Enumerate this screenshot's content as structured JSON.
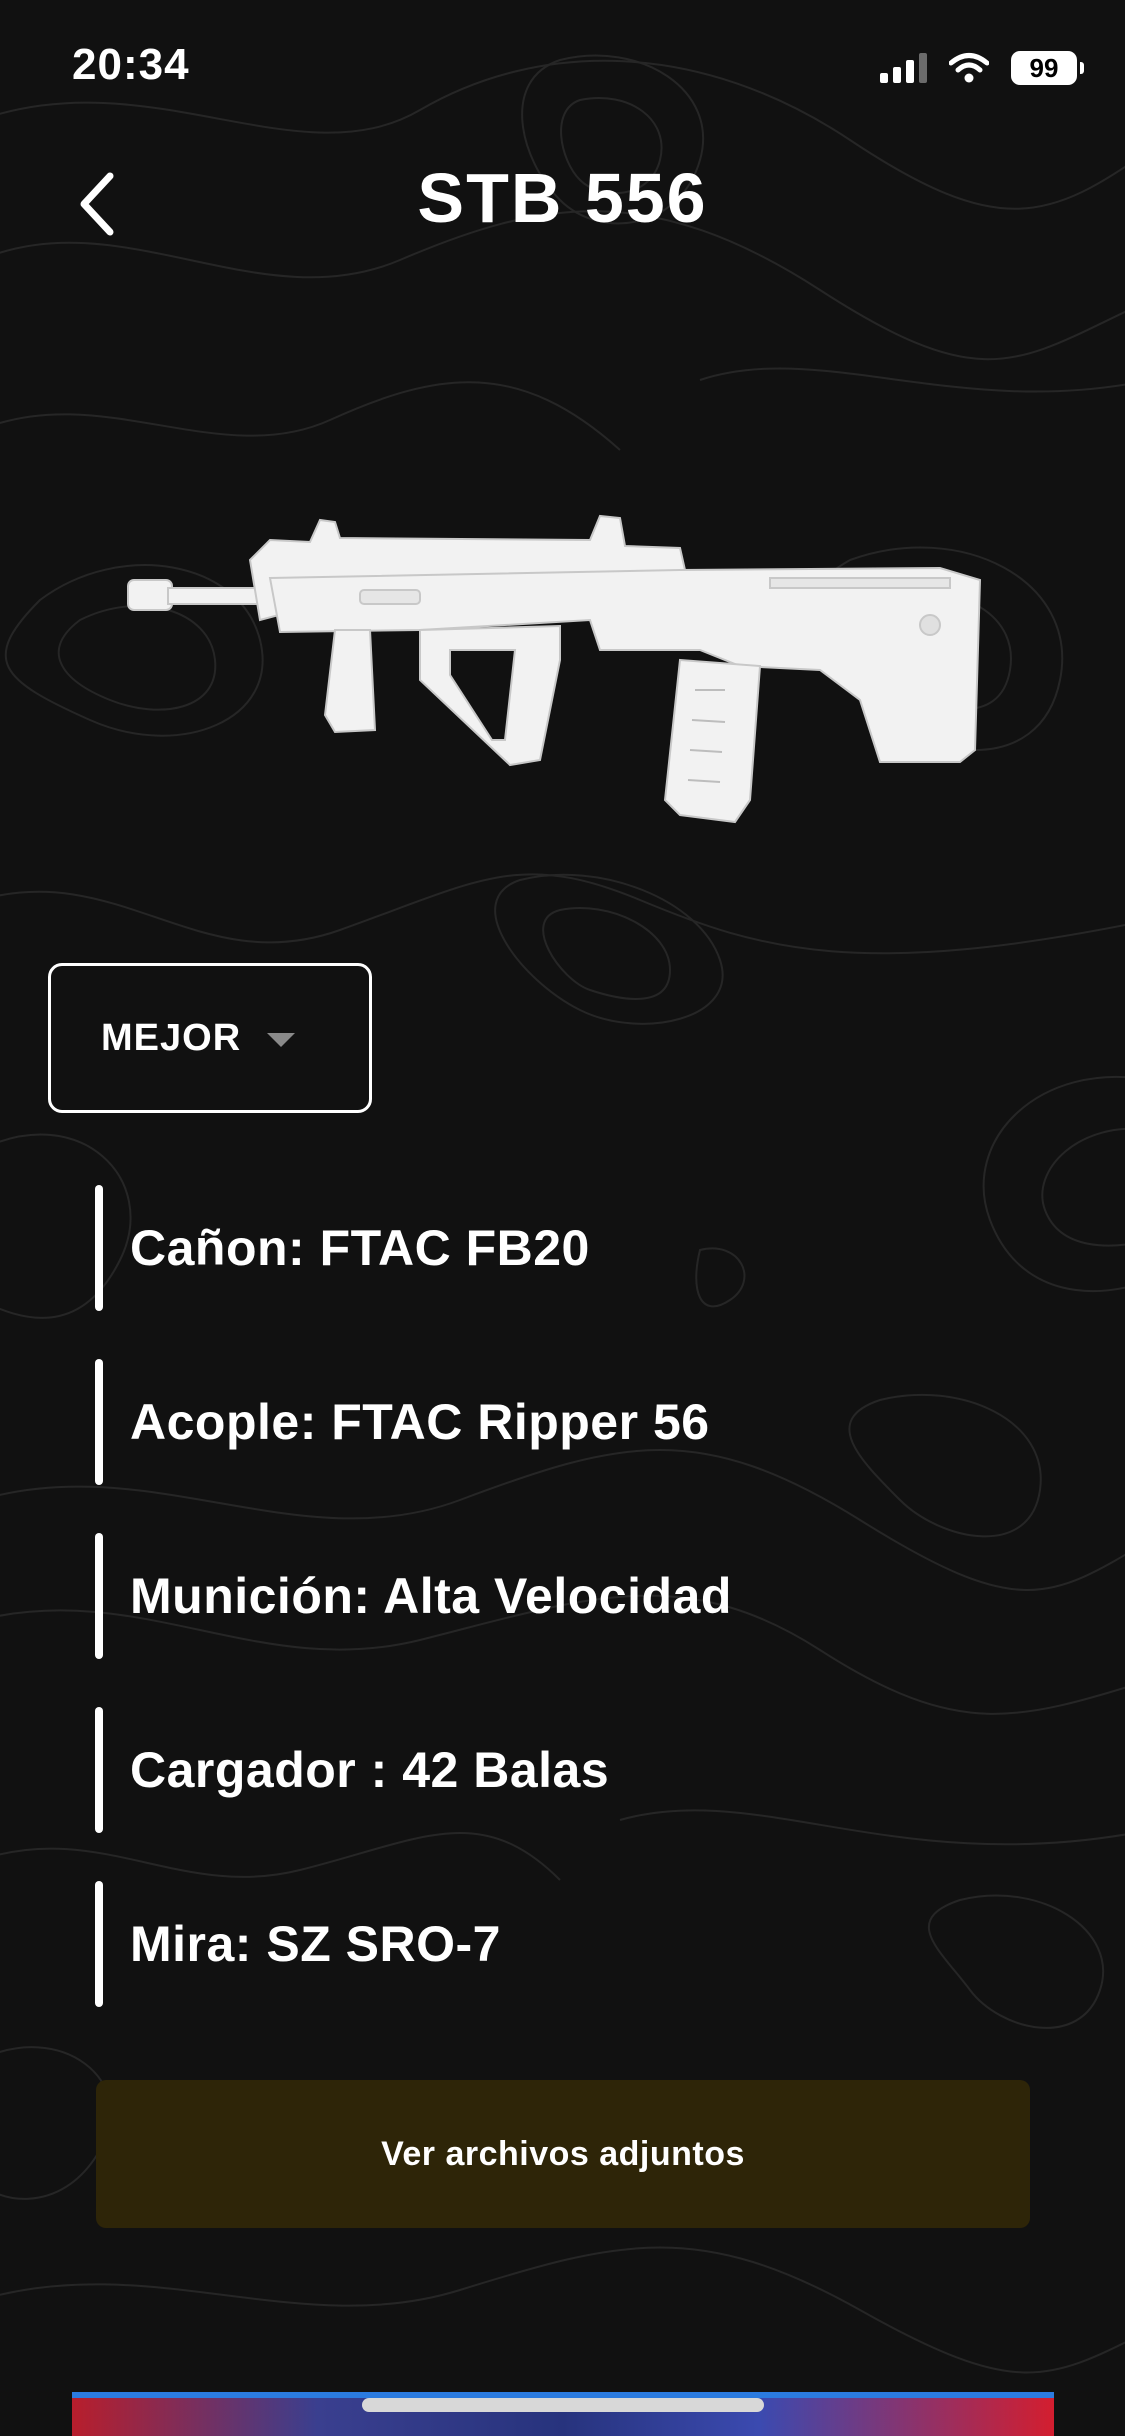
{
  "status_bar": {
    "time": "20:34",
    "battery": "99",
    "icons": [
      "cellular-signal-icon",
      "wifi-icon",
      "battery-icon"
    ]
  },
  "header": {
    "title": "STB 556",
    "back_icon": "chevron-left-icon"
  },
  "weapon": {
    "image": "white-bullpup-rifle"
  },
  "loadout_selector": {
    "selected": "MEJOR",
    "caret_icon": "caret-down-icon"
  },
  "attachments": [
    {
      "text": "Cañon: FTAC FB20"
    },
    {
      "text": "Acople: FTAC Ripper 56"
    },
    {
      "text": "Munición: Alta Velocidad"
    },
    {
      "text": "Cargador : 42 Balas"
    },
    {
      "text": "Mira: SZ SRO-7"
    }
  ],
  "actions": {
    "view_attachments_label": "Ver archivos adjuntos"
  },
  "colors": {
    "background": "#111111",
    "button_bg": "#2e2508",
    "text": "#ffffff"
  }
}
